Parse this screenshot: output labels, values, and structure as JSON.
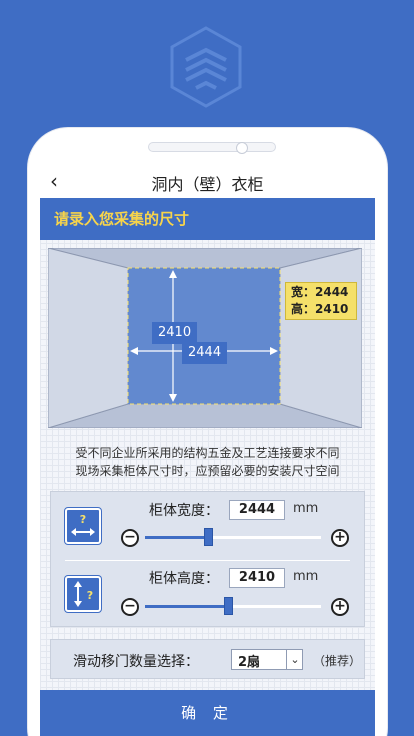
{
  "app": {
    "logo_icon": "hexagon-stack-logo",
    "accent": "#3f6dc4",
    "highlight": "#f7d44b"
  },
  "nav": {
    "back_icon": "‹",
    "title": "洞内（壁）衣柜"
  },
  "section": {
    "title": "请录入您采集的尺寸"
  },
  "room": {
    "height_label": "2410",
    "width_label": "2444",
    "size_box": {
      "width_line": "宽：2444",
      "height_line": "高：2410"
    }
  },
  "notice": {
    "line1": "受不同企业所采用的结构五金及工艺连接要求不同",
    "line2": "现场采集柜体尺寸时，应预留必要的安装尺寸空间"
  },
  "width_control": {
    "label": "柜体宽度：",
    "value": "2444",
    "unit": "mm",
    "minus": "−",
    "plus": "+",
    "slider_level": 0.36,
    "icon": "width-help-icon"
  },
  "height_control": {
    "label": "柜体高度：",
    "value": "2410",
    "unit": "mm",
    "minus": "−",
    "plus": "+",
    "slider_level": 0.47,
    "icon": "height-help-icon"
  },
  "door": {
    "label": "滑动移门数量选择：",
    "selected": "2扇",
    "caret": "⌄",
    "recommend": "（推荐）"
  },
  "confirm": {
    "label": "确 定"
  }
}
